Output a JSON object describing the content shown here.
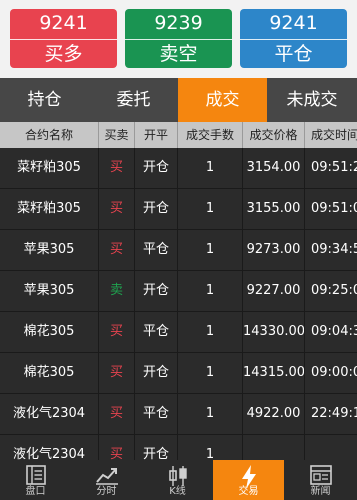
{
  "trade_buttons": [
    {
      "price": "9241",
      "label": "买多"
    },
    {
      "price": "9239",
      "label": "卖空"
    },
    {
      "price": "9241",
      "label": "平仓"
    }
  ],
  "tabs": [
    {
      "label": "持仓"
    },
    {
      "label": "委托"
    },
    {
      "label": "成交"
    },
    {
      "label": "未成交"
    }
  ],
  "active_tab": "成交",
  "table": {
    "headers": [
      "合约名称",
      "买卖",
      "开平",
      "成交手数",
      "成交价格",
      "成交时间"
    ],
    "rows": [
      {
        "contract": "菜籽粕305",
        "side": "买",
        "offset": "开仓",
        "lots": "1",
        "price": "3154.00",
        "time": "09:51:2"
      },
      {
        "contract": "菜籽粕305",
        "side": "买",
        "offset": "开仓",
        "lots": "1",
        "price": "3155.00",
        "time": "09:51:0"
      },
      {
        "contract": "苹果305",
        "side": "买",
        "offset": "平仓",
        "lots": "1",
        "price": "9273.00",
        "time": "09:34:5"
      },
      {
        "contract": "苹果305",
        "side": "卖",
        "offset": "开仓",
        "lots": "1",
        "price": "9227.00",
        "time": "09:25:0"
      },
      {
        "contract": "棉花305",
        "side": "买",
        "offset": "平仓",
        "lots": "1",
        "price": "14330.00",
        "time": "09:04:3"
      },
      {
        "contract": "棉花305",
        "side": "买",
        "offset": "开仓",
        "lots": "1",
        "price": "14315.00",
        "time": "09:00:0"
      },
      {
        "contract": "液化气2304",
        "side": "买",
        "offset": "平仓",
        "lots": "1",
        "price": "4922.00",
        "time": "22:49:1"
      },
      {
        "contract": "液化气2304",
        "side": "买",
        "offset": "开仓",
        "lots": "1",
        "price": "",
        "time": ""
      }
    ]
  },
  "bottom_nav": [
    {
      "label": "盘口",
      "icon": "orderbook-icon"
    },
    {
      "label": "分时",
      "icon": "timeshare-chart-icon"
    },
    {
      "label": "K线",
      "icon": "candlestick-icon"
    },
    {
      "label": "交易",
      "icon": "lightning-icon"
    },
    {
      "label": "新闻",
      "icon": "news-icon"
    }
  ],
  "colors": {
    "buy": "#e8434f",
    "sell": "#1a9452",
    "close": "#2d86c9",
    "accent": "#f5860f"
  }
}
